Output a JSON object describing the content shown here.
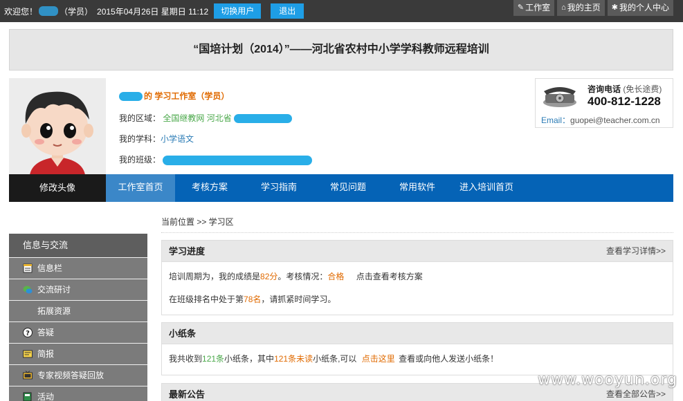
{
  "topbar": {
    "welcome": "欢迎您！",
    "role": "（学员）",
    "datetime": "2015年04月26日 星期日 11:12",
    "switch_user": "切换用户",
    "logout": "退出",
    "links": [
      {
        "icon": "edit-icon",
        "label": "工作室"
      },
      {
        "icon": "home-icon",
        "label": "我的主页"
      },
      {
        "icon": "gear-icon",
        "label": "我的个人中心"
      }
    ]
  },
  "title": "“国培计划（2014）”——河北省农村中小学学科教师远程培训",
  "profile": {
    "studio_label": "的 学习工作室（学员）",
    "region_label": "我的区域：",
    "region_value": "全国继教网 河北省",
    "subject_label": "我的学科：",
    "subject_value": "小学语文",
    "class_label": "我的班级："
  },
  "contact": {
    "hotline_label": "咨询电话",
    "hotline_note": "(免长途费)",
    "phone": "400-812-1228",
    "email_label": "Email：",
    "email": "guopei@teacher.com.cn"
  },
  "nav": {
    "avatar_button": "修改头像",
    "items": [
      "工作室首页",
      "考核方案",
      "学习指南",
      "常见问题",
      "常用软件",
      "进入培训首页"
    ]
  },
  "sidebar": {
    "header": "信息与交流",
    "items": [
      "信息栏",
      "交流研讨",
      "拓展资源",
      "答疑",
      "简报",
      "专家视频答疑回放",
      "活动"
    ]
  },
  "breadcrumb": "当前位置 >> 学习区",
  "progress": {
    "title": "学习进度",
    "more": "查看学习详情>>",
    "l1_a": "培训周期为，我的成绩是",
    "score": "82分",
    "l1_b": "。考核情况：",
    "status": "合格",
    "l1_c": "点击查看考核方案",
    "l2_a": "在班级排名中处于第",
    "rank": "78名",
    "l2_b": "，请抓紧时间学习。"
  },
  "notes": {
    "title": "小纸条",
    "t1": "我共收到",
    "total": "121条",
    "t2": "小纸条，其中",
    "unread": "121条未读",
    "t3": "小纸条,可以",
    "link": "点击这里",
    "t4": "查看或向他人发送小纸条！"
  },
  "notice": {
    "title": "最新公告",
    "more": "查看全部公告>>"
  },
  "watermark": "www.wooyun.org"
}
